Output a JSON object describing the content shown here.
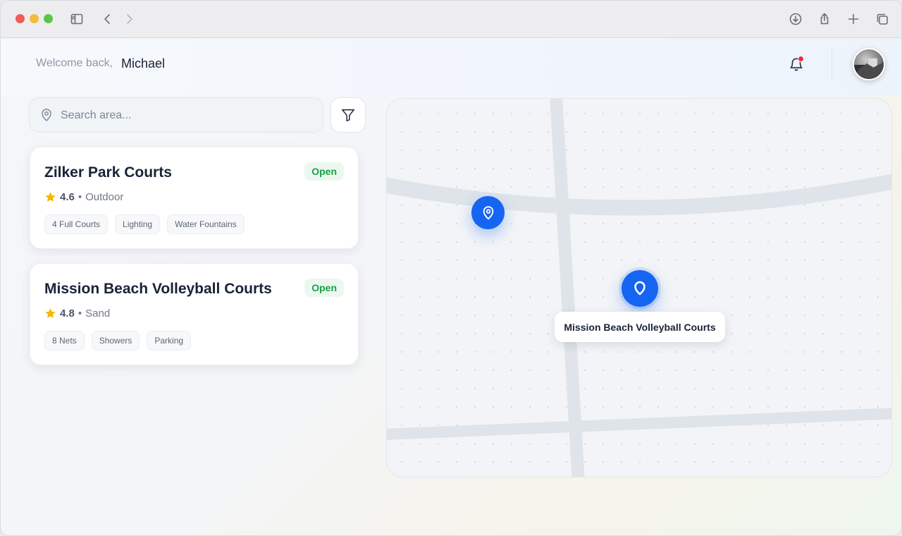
{
  "browser": {
    "icons": [
      "sidebar-icon",
      "back-icon",
      "forward-icon",
      "download-icon",
      "share-icon",
      "new-tab-icon",
      "tabs-icon"
    ]
  },
  "header": {
    "welcome": "Welcome back,",
    "username": "Michael",
    "has_notification": true
  },
  "search": {
    "placeholder": "Search area...",
    "value": ""
  },
  "courts": [
    {
      "name": "Zilker Park Courts",
      "status": "Open",
      "rating": "4.6",
      "type": "Outdoor",
      "tags": [
        "4 Full Courts",
        "Lighting",
        "Water Fountains"
      ]
    },
    {
      "name": "Mission Beach Volleyball Courts",
      "status": "Open",
      "rating": "4.8",
      "type": "Sand",
      "tags": [
        "8 Nets",
        "Showers",
        "Parking"
      ]
    }
  ],
  "map": {
    "tooltip": "Mission Beach Volleyball Courts"
  },
  "colors": {
    "accent": "#1665f2",
    "open_badge": "#18a046",
    "star": "#f5b800",
    "notification": "#ee2b3a"
  }
}
